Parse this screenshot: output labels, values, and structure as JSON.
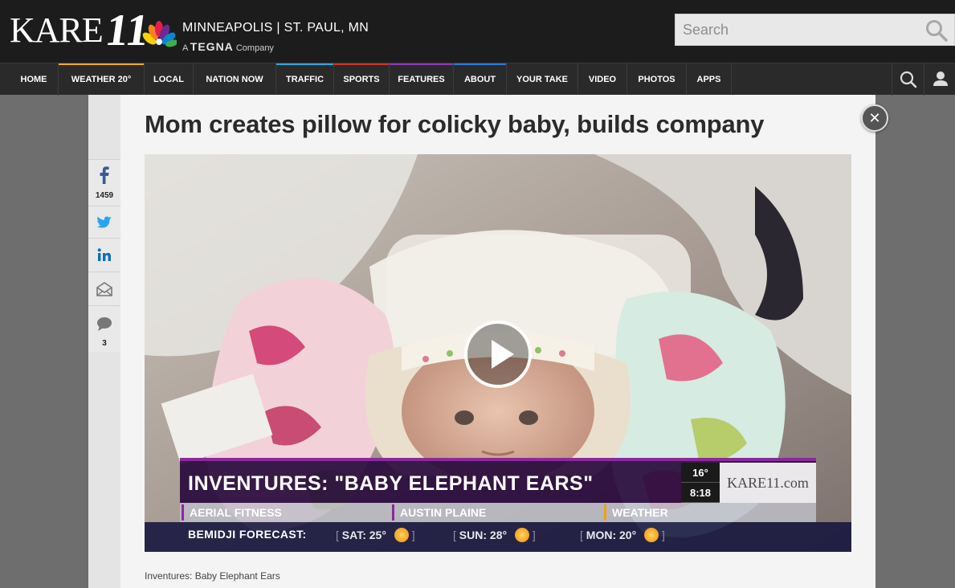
{
  "brand": {
    "logo_text": "KARE",
    "logo_number": "11",
    "location": "MINNEAPOLIS | ST. PAUL, MN",
    "tagline_prefix": "A",
    "tagline_brand": "TEGNA",
    "tagline_suffix": "Company"
  },
  "search": {
    "placeholder": "Search"
  },
  "nav": {
    "items": [
      {
        "label": "HOME",
        "accent": ""
      },
      {
        "label": "WEATHER  20°",
        "accent": "#f2a81d"
      },
      {
        "label": "LOCAL",
        "accent": ""
      },
      {
        "label": "NATION NOW",
        "accent": ""
      },
      {
        "label": "TRAFFIC",
        "accent": "#2aa8d8"
      },
      {
        "label": "SPORTS",
        "accent": "#d2322d"
      },
      {
        "label": "FEATURES",
        "accent": "#8a3ab9"
      },
      {
        "label": "ABOUT",
        "accent": "#2a7ad8"
      },
      {
        "label": "YOUR TAKE",
        "accent": ""
      },
      {
        "label": "VIDEO",
        "accent": ""
      },
      {
        "label": "PHOTOS",
        "accent": ""
      },
      {
        "label": "APPS",
        "accent": ""
      }
    ]
  },
  "share": {
    "facebook_count": "1459",
    "comments_count": "3"
  },
  "article": {
    "headline": "Mom creates pillow for colicky baby, builds company",
    "caption": "Inventures: Baby Elephant Ears"
  },
  "video": {
    "lower_third_title": "INVENTURES: \"BABY ELEPHANT EARS\"",
    "temp": "16°",
    "time": "8:18",
    "channel_logo": "KARE11.com",
    "ticker": [
      {
        "label": "AERIAL FITNESS",
        "color": "#8a2a9c"
      },
      {
        "label": "AUSTIN PLAINE",
        "color": "#8a2a9c"
      },
      {
        "label": "WEATHER",
        "color": "#e8a317"
      }
    ],
    "forecast_label": "BEMIDJI FORECAST:",
    "forecast": [
      {
        "day": "SAT:",
        "temp": "25°"
      },
      {
        "day": "SUN:",
        "temp": "28°"
      },
      {
        "day": "MON:",
        "temp": "20°"
      }
    ]
  }
}
